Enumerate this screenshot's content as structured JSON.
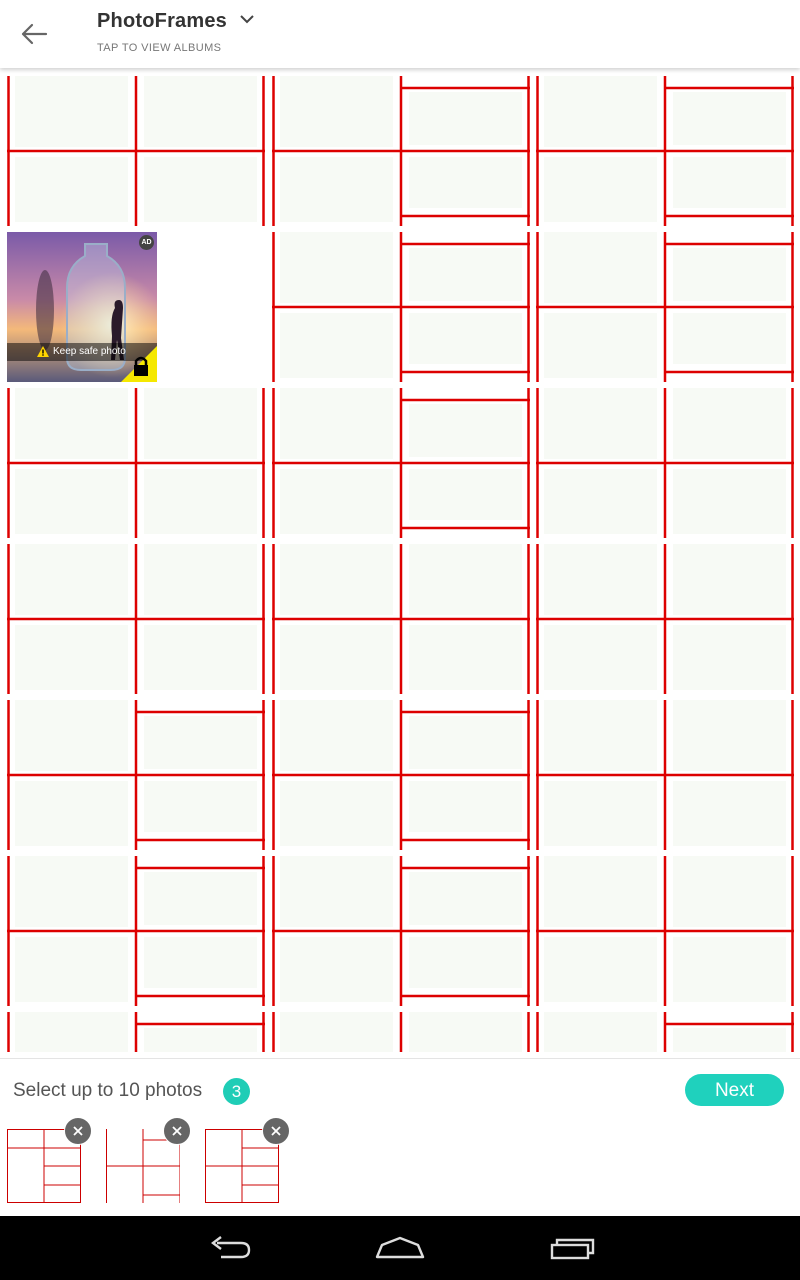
{
  "header": {
    "title": "PhotoFrames",
    "subtitle": "TAP TO VIEW ALBUMS"
  },
  "grid": {
    "row_count": 7,
    "col_count": 3,
    "ad": {
      "row": 1,
      "col": 0,
      "badge": "AD",
      "caption": "Keep safe photo"
    },
    "frame_types": [
      [
        "grid4",
        "tall_right",
        "tall_right"
      ],
      [
        "ad",
        "tall_right",
        "tall_right"
      ],
      [
        "grid4",
        "tall_right",
        "grid4"
      ],
      [
        "grid4",
        "grid4",
        "grid4"
      ],
      [
        "tall_right",
        "tall_right",
        "grid4"
      ],
      [
        "tall_right",
        "tall_right",
        "grid4"
      ],
      [
        "tall_right",
        "grid4",
        "tall_right"
      ]
    ]
  },
  "tray": {
    "label": "Select up to 10 photos",
    "count": "3",
    "next_label": "Next",
    "selected": [
      "frame-a",
      "frame-b",
      "frame-c"
    ]
  },
  "colors": {
    "frame_line": "#dd0000",
    "cell_fill": "#f7faf5",
    "accent": "#1fd1bd"
  },
  "icons": {
    "back": "back-arrow-icon",
    "dropdown": "chevron-down-icon",
    "remove": "close-icon",
    "nav_back": "nav-back-icon",
    "nav_home": "nav-home-icon",
    "nav_recents": "nav-recents-icon"
  }
}
